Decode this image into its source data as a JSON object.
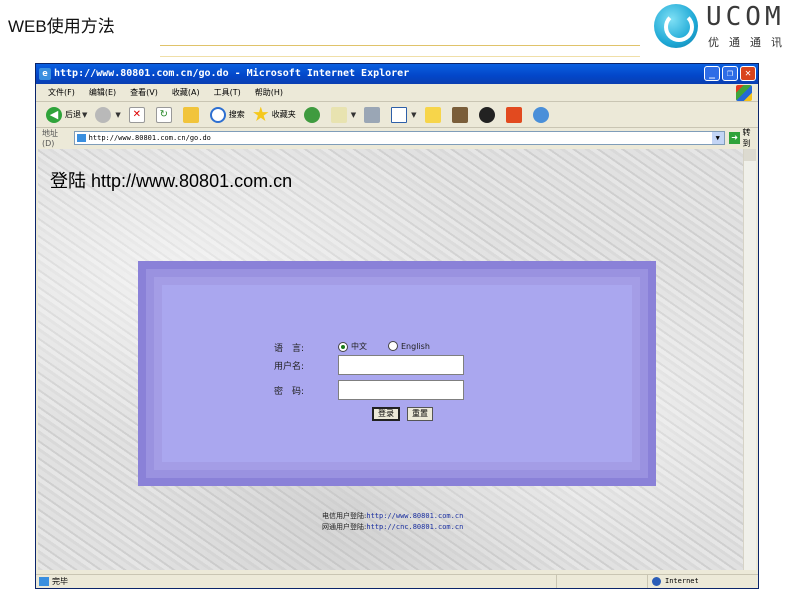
{
  "slide": {
    "title": "WEB使用方法",
    "logo_text": "UCOM",
    "logo_sub": "优通通讯"
  },
  "browser": {
    "title": "http://www.80801.com.cn/go.do - Microsoft Internet Explorer",
    "menu": [
      "文件(F)",
      "编辑(E)",
      "查看(V)",
      "收藏(A)",
      "工具(T)",
      "帮助(H)"
    ],
    "toolbar": {
      "back_label": "后退",
      "search_label": "搜索",
      "favorites_label": "收藏夹"
    },
    "address": {
      "label": "地址(D)",
      "value": "http://www.80801.com.cn/go.do",
      "go_label": "转到"
    },
    "status": {
      "text": "完毕",
      "zone": "Internet"
    }
  },
  "page": {
    "heading": "登陆 http://www.80801.com.cn",
    "form": {
      "language_label": "语　言:",
      "lang_chinese": "中文",
      "lang_english": "English",
      "selected_language": "中文",
      "username_label": "用户名:",
      "password_label": "密　码:",
      "username_value": "",
      "password_value": "",
      "login_button": "登录",
      "reset_button": "重置"
    },
    "footer": {
      "telecom_label": "电信用户登陆:",
      "telecom_url": "http://www.80801.com.cn",
      "cnc_label": "网通用户登陆:",
      "cnc_url": "http://cnc.80801.com.cn"
    }
  }
}
